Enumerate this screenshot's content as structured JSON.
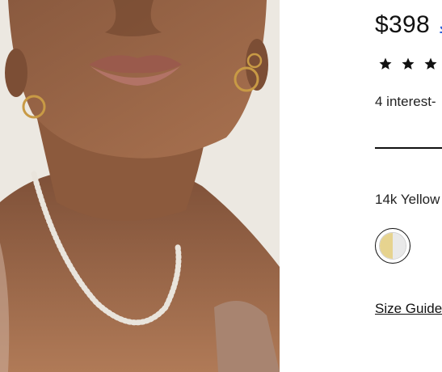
{
  "product": {
    "price": "$398",
    "price_link": "J",
    "rating": {
      "stars_shown": 3,
      "star_icon": "star-icon"
    },
    "installments_text": "4 interest-",
    "metal_label": "14k Yellow",
    "swatch": {
      "left_color": "#e6d38f",
      "right_color": "#e9e9e9"
    },
    "size_guide": "Size Guide"
  },
  "colors": {
    "link": "#2b5fd9",
    "text": "#111111",
    "photo_bg": "#ece8e1"
  }
}
